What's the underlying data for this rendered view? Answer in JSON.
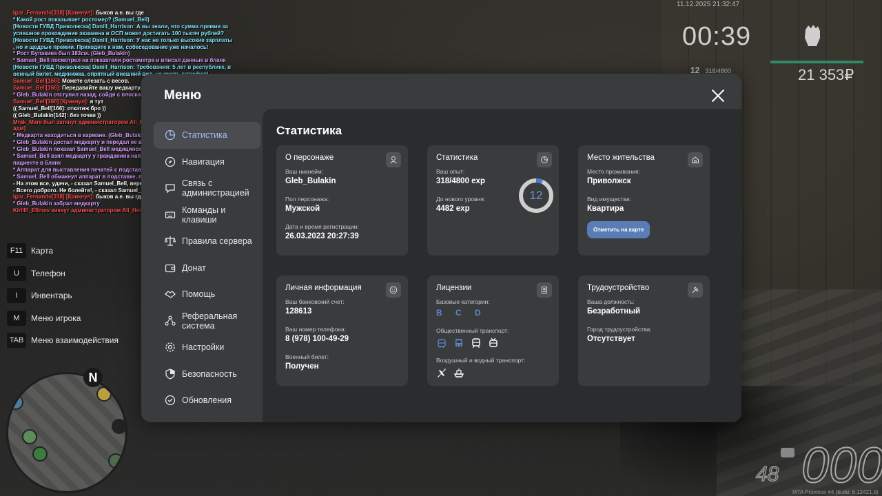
{
  "chat": [
    {
      "parts": [
        {
          "c": "red",
          "t": "Igor_Fernando[318] [Крикнул]: "
        },
        {
          "c": "white",
          "t": "быков а.е. вы где"
        }
      ]
    },
    {
      "parts": [
        {
          "c": "cyan",
          "t": " * Какой рост показывает ростомер? (Samuel_Bell)"
        }
      ]
    },
    {
      "parts": [
        {
          "c": "cyan",
          "t": "[Новости ГУВД Приволжска] Daniil_Harrison: А вы знали, что сумма премии за"
        }
      ]
    },
    {
      "parts": [
        {
          "c": "cyan",
          "t": " успешное прохождение экзамена в ОСП может достигать 100 тысяч рублей?"
        }
      ]
    },
    {
      "parts": [
        {
          "c": "cyan",
          "t": "[Новости ГУВД Приволжска] Daniil_Harrison: У нас не только высокие зарплаты"
        }
      ]
    },
    {
      "parts": [
        {
          "c": "cyan",
          "t": ", но и щедрые премии. Приходите к нам, собеседование уже началось!"
        }
      ]
    },
    {
      "parts": [
        {
          "c": "pink",
          "t": " * Рост Булакина был 183см. (Gleb_Bulakin)"
        }
      ]
    },
    {
      "parts": [
        {
          "c": "pink",
          "t": " * Samuel_Bell посмотрел на показатели ростометра и вписал данные в бланк"
        }
      ]
    },
    {
      "parts": [
        {
          "c": "cyan",
          "t": "[Новости ГУВД Приволжска] Daniil_Harrison: Требования: 5 лет в республике, в"
        }
      ]
    },
    {
      "parts": [
        {
          "c": "cyan",
          "t": "оенный билет, медкнижка, опрятный внешний вид, не иметь штрафов!"
        }
      ]
    },
    {
      "parts": [
        {
          "c": "red",
          "t": "Samuel_Bell[166]: "
        },
        {
          "c": "white",
          "t": "Можете слезать с весов."
        }
      ]
    },
    {
      "parts": [
        {
          "c": "red",
          "t": "Samuel_Bell[166]: "
        },
        {
          "c": "white",
          "t": "Передавайте вашу медкарту."
        }
      ]
    },
    {
      "parts": [
        {
          "c": "pink",
          "t": " * Gleb_Bulakin отступил назад, сойдя с плоскости весов"
        }
      ]
    },
    {
      "parts": [
        {
          "c": "red",
          "t": "Samuel_Bell[166] [Крикнул]: "
        },
        {
          "c": "white",
          "t": "я тут"
        }
      ]
    },
    {
      "parts": [
        {
          "c": "white",
          "t": "(( Samuel_Bell[166]: откатиж бро ))"
        }
      ]
    },
    {
      "parts": [
        {
          "c": "white",
          "t": "(( Gleb_Bulakin[142]: без точки ))"
        }
      ]
    },
    {
      "parts": [
        {
          "c": "red",
          "t": "Mrak_Mare был заткнут администратором Ali_Henderson (1 час) [неадекват к"
        }
      ]
    },
    {
      "parts": [
        {
          "c": "red",
          "t": " адм]"
        }
      ]
    },
    {
      "parts": [
        {
          "c": "pink",
          "t": " * Медкарта находиться в кармане. (Gleb_Bulakin)"
        }
      ]
    },
    {
      "parts": [
        {
          "c": "pink",
          "t": " * Gleb_Bulakin достал медкарту и передал ее врачу для проверки"
        }
      ]
    },
    {
      "parts": [
        {
          "c": "pink",
          "t": " * Gleb_Bulakin показал Samuel_Bell медицинскую карту"
        }
      ]
    },
    {
      "parts": [
        {
          "c": "pink",
          "t": " * Samuel_Bell взял медкарту у гражданина напротив и зафиксировал данные о"
        }
      ]
    },
    {
      "parts": [
        {
          "c": "pink",
          "t": "пациенте в бланк"
        }
      ]
    },
    {
      "parts": [
        {
          "c": "pink",
          "t": " * Аппарат для выставления печатей с подставкой стоит на столе. (Samuel_Bell)"
        }
      ]
    },
    {
      "parts": [
        {
          "c": "pink",
          "t": " * Samuel_Bell обмакнул аппарат в подставке, поставил печать"
        }
      ]
    },
    {
      "parts": [
        {
          "c": "white",
          "t": " - На этом все, удачи, - сказал Samuel_Bell, вернув медкарту владельцу"
        }
      ]
    },
    {
      "parts": [
        {
          "c": "white",
          "t": " - Всего доброго. Не болейте!, - сказал Samuel_Bell, улыбнувшись"
        }
      ]
    },
    {
      "parts": [
        {
          "c": "red",
          "t": "Igor_Fernando[318] [Крикнул]: "
        },
        {
          "c": "white",
          "t": "быков а.е. вы где"
        }
      ]
    },
    {
      "parts": [
        {
          "c": "pink",
          "t": " * Gleb_Bulakin забрал медкарту"
        }
      ]
    },
    {
      "parts": [
        {
          "c": "red",
          "t": "Kirillll_Efimov кикнут администратором Ali_Henderson (dm zz)"
        }
      ]
    }
  ],
  "hotkeys": [
    {
      "key": "F11",
      "label": "Карта"
    },
    {
      "key": "U",
      "label": "Телефон"
    },
    {
      "key": "I",
      "label": "Инвентарь"
    },
    {
      "key": "M",
      "label": "Меню игрока"
    },
    {
      "key": "TAB",
      "label": "Меню взаимодействия"
    }
  ],
  "minimap": {
    "north": "N"
  },
  "hud": {
    "date": "11.12.2025 21:32:47",
    "timer": "00:39",
    "level": "12",
    "exp": "318/4800",
    "money": "21 353₽"
  },
  "vehicle": {
    "speed": "000",
    "fuel": "48",
    "build": "MTA Province #4 (build: 6.12421.9)"
  },
  "menu": {
    "title": "Меню",
    "nav": [
      {
        "id": "stats",
        "label": "Статистика",
        "icon": "pie-chart-icon",
        "active": true
      },
      {
        "id": "navigation",
        "label": "Навигация",
        "icon": "compass-icon"
      },
      {
        "id": "admin",
        "label": "Связь с администрацией",
        "icon": "chat-icon"
      },
      {
        "id": "commands",
        "label": "Команды и клавиши",
        "icon": "keyboard-icon"
      },
      {
        "id": "rules",
        "label": "Правила сервера",
        "icon": "scales-icon"
      },
      {
        "id": "donate",
        "label": "Донат",
        "icon": "wallet-icon"
      },
      {
        "id": "help",
        "label": "Помощь",
        "icon": "handshake-icon"
      },
      {
        "id": "referral",
        "label": "Реферальная система",
        "icon": "network-icon"
      },
      {
        "id": "settings",
        "label": "Настройки",
        "icon": "gear-icon"
      },
      {
        "id": "security",
        "label": "Безопасность",
        "icon": "shield-icon"
      },
      {
        "id": "updates",
        "label": "Обновления",
        "icon": "refresh-icon"
      }
    ],
    "content_title": "Статистика",
    "cards": {
      "character": {
        "title": "О персонаже",
        "nick_label": "Ваш никнейм:",
        "nick": "Gleb_Bulakin",
        "gender_label": "Пол персонажа:",
        "gender": "Мужской",
        "reg_label": "Дата и время регистрации:",
        "reg": "26.03.2023 20:27:39"
      },
      "stats": {
        "title": "Статистика",
        "exp_label": "Ваш опыт:",
        "exp": "318/4800 exp",
        "next_label": "До нового уровня:",
        "next": "4482 exp",
        "level": "12",
        "progress": 0.066
      },
      "residence": {
        "title": "Место жительства",
        "place_label": "Место проживания:",
        "place": "Приволжск",
        "property_label": "Вид имущества:",
        "property": "Квартира",
        "map_button": "Отметить на карте"
      },
      "personal": {
        "title": "Личная информация",
        "bank_label": "Ваш банковский счет:",
        "bank": "128613",
        "phone_label": "Ваш номер телефона:",
        "phone": "8 (978) 100-49-29",
        "military_label": "Военный билет:",
        "military": "Получен"
      },
      "licenses": {
        "title": "Лицензии",
        "base_label": "Базовые категории:",
        "base": "B C D",
        "public_label": "Общественный транспорт:",
        "air_label": "Воздушный и водный транспорт:"
      },
      "employment": {
        "title": "Трудоустройство",
        "position_label": "Ваша должность:",
        "position": "Безработный",
        "city_label": "Город трудоустройства:",
        "city": "Отсутствует"
      }
    }
  },
  "colors": {
    "accent": "#5a7db6",
    "active_nav": "#9fbff5",
    "ring": "#4f7ad1",
    "panel": "#3a3b3d",
    "content_bg": "#2b2c2e"
  }
}
